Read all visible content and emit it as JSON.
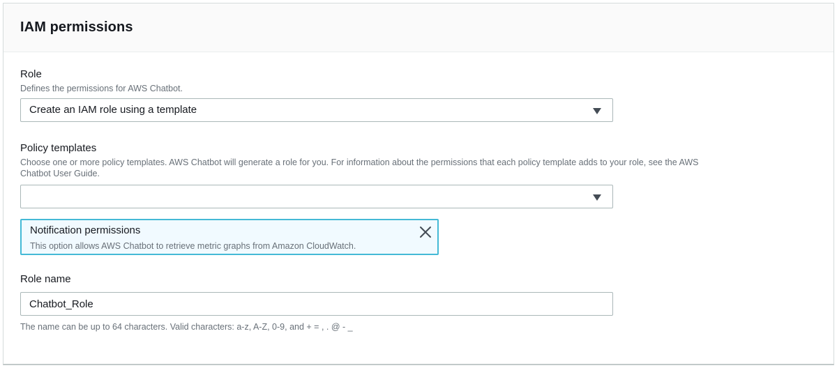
{
  "panel": {
    "title": "IAM permissions"
  },
  "role": {
    "label": "Role",
    "description": "Defines the permissions for AWS Chatbot.",
    "selected_value": "Create an IAM role using a template"
  },
  "policy_templates": {
    "label": "Policy templates",
    "description_line1": "Choose one or more policy templates. AWS Chatbot will generate a role for you. For information about the permissions that each policy template adds to your role, see the AWS",
    "description_line2": "Chatbot User Guide.",
    "selected_value": "",
    "tokens": [
      {
        "title": "Notification permissions",
        "description": "This option allows AWS Chatbot to retrieve metric graphs from Amazon CloudWatch."
      }
    ]
  },
  "role_name": {
    "label": "Role name",
    "value": "Chatbot_Role",
    "hint": "The name can be up to 64 characters. Valid characters: a-z, A-Z, 0-9, and + = , . @ - _"
  },
  "icons": {
    "dropdown": "caret-down-icon",
    "remove_token": "close-icon"
  },
  "colors": {
    "token_border": "#44b9d6",
    "token_background": "#f1faff",
    "muted_text": "#687078"
  }
}
